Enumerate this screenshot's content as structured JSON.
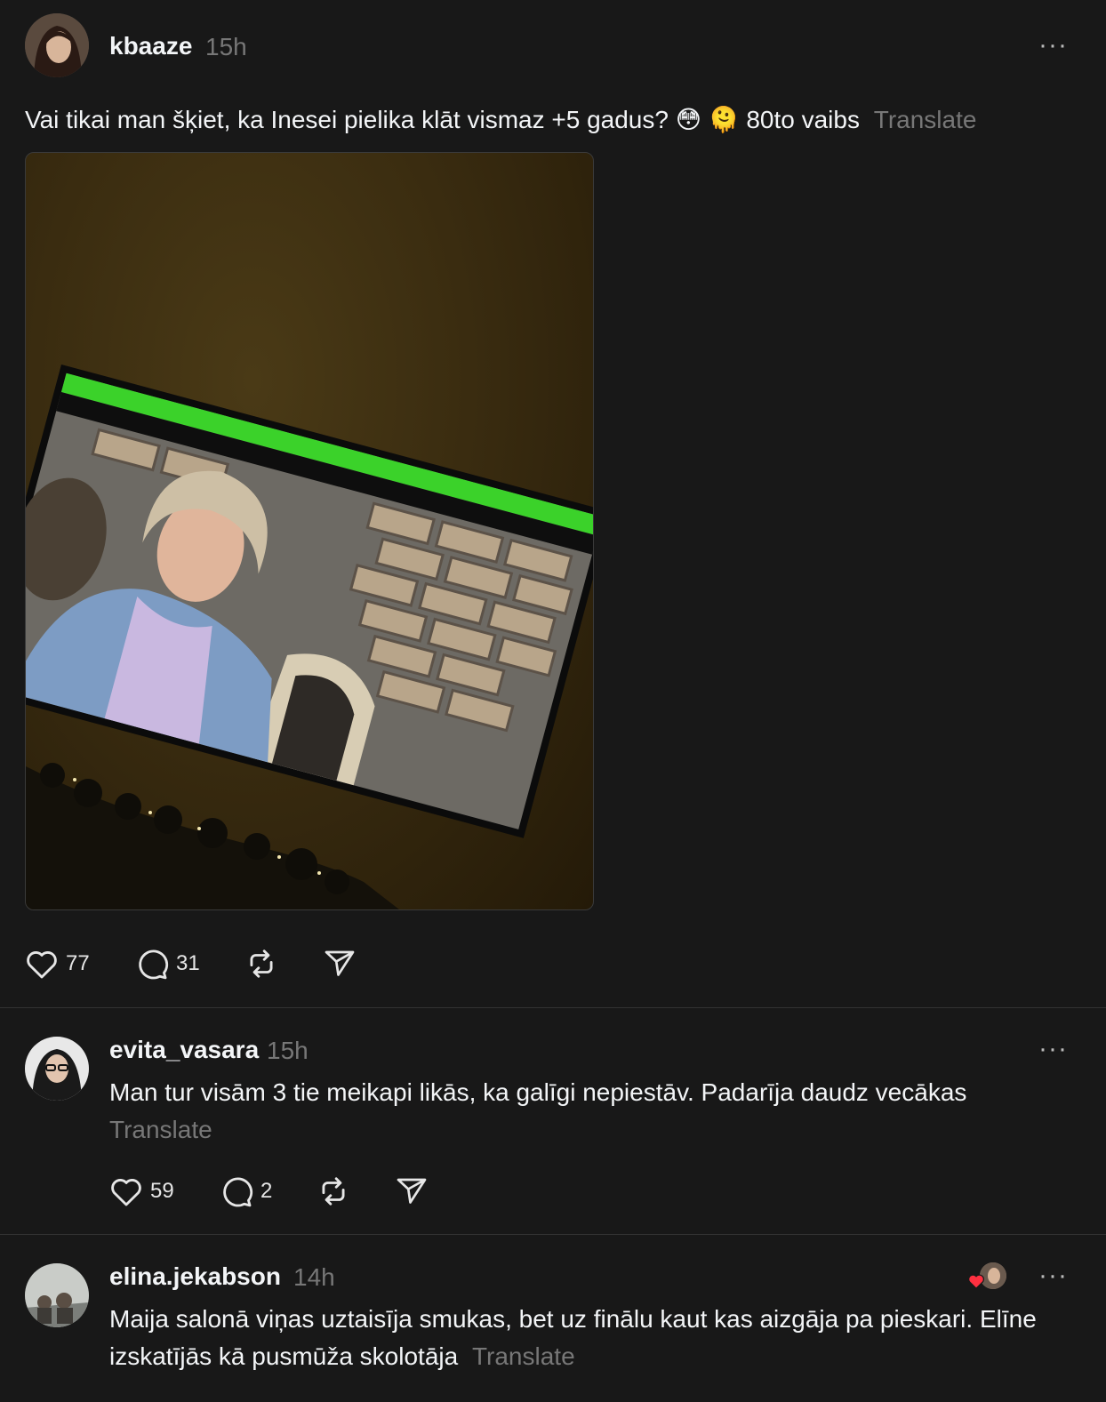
{
  "posts": [
    {
      "username": "kbaaze",
      "time": "15h",
      "more": "···",
      "text": "Vai tikai man šķiet, ka Inesei pielika klāt vismaz +5 gadus? 😳 🫠 80to vaibs",
      "translate": "Translate",
      "likes": "77",
      "comments": "31"
    },
    {
      "username": "evita_vasara",
      "time": "15h",
      "more": "···",
      "text": "Man tur visām 3 tie meikapi likās, ka galīgi nepiestāv. Padarīja daudz vecākas",
      "translate": "Translate",
      "likes": "59",
      "comments": "2"
    },
    {
      "username": "elina.jekabson",
      "time": "14h",
      "more": "···",
      "text": "Maija salonā viņas uztaisīja smukas, bet uz finālu kaut kas aizgāja pa pieskari. Elīne izskatījās kā pusmūža skolotāja",
      "translate": "Translate"
    }
  ],
  "icons": {
    "like": "heart-icon",
    "comment": "comment-icon",
    "repost": "repost-icon",
    "share": "share-icon",
    "liked_by": "liked-by-avatar-heart-icon"
  },
  "colors": {
    "background": "#181818",
    "text": "#f3f5f7",
    "muted": "#777777",
    "divider": "#333333",
    "heart": "#ff3040",
    "tv_banner": "#3bd22a"
  }
}
